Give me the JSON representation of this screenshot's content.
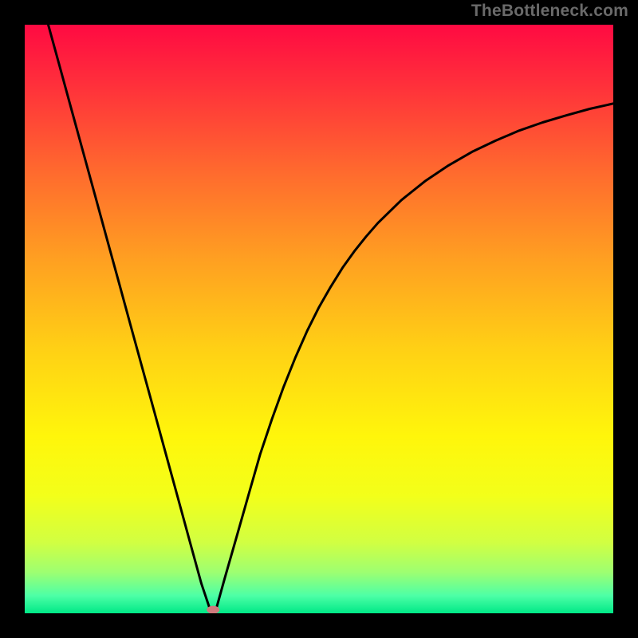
{
  "watermark": "TheBottleneck.com",
  "chart_data": {
    "type": "line",
    "title": "",
    "xlabel": "",
    "ylabel": "",
    "xlim": [
      0,
      100
    ],
    "ylim": [
      0,
      100
    ],
    "grid": false,
    "legend": false,
    "series": [
      {
        "name": "bottleneck-curve",
        "x": [
          4,
          6,
          8,
          10,
          12,
          14,
          16,
          18,
          20,
          22,
          24,
          26,
          28,
          30,
          31.5,
          32.5,
          34,
          36,
          38,
          40,
          42,
          44,
          46,
          48,
          50,
          52,
          54,
          56,
          58,
          60,
          64,
          68,
          72,
          76,
          80,
          84,
          88,
          92,
          96,
          100
        ],
        "values": [
          100,
          92.7,
          85.4,
          78.1,
          70.8,
          63.5,
          56.2,
          48.9,
          41.6,
          34.3,
          27.0,
          19.7,
          12.4,
          5.1,
          0.6,
          0.6,
          6.0,
          13.0,
          20.0,
          27.0,
          33.0,
          38.5,
          43.5,
          48.0,
          52.0,
          55.5,
          58.7,
          61.5,
          64.0,
          66.3,
          70.2,
          73.4,
          76.1,
          78.4,
          80.3,
          82.0,
          83.4,
          84.6,
          85.7,
          86.6
        ]
      }
    ],
    "annotations": [
      {
        "name": "min-marker",
        "x": 32,
        "y": 0.6,
        "shape": "ellipse",
        "color": "#cf7a7d"
      }
    ],
    "background_gradient": {
      "type": "vertical",
      "stops": [
        {
          "pos": 0.0,
          "color": "#ff0a42"
        },
        {
          "pos": 0.1,
          "color": "#ff2f3b"
        },
        {
          "pos": 0.25,
          "color": "#ff6a2e"
        },
        {
          "pos": 0.4,
          "color": "#ffa021"
        },
        {
          "pos": 0.55,
          "color": "#ffd015"
        },
        {
          "pos": 0.7,
          "color": "#fff60b"
        },
        {
          "pos": 0.8,
          "color": "#f3ff1a"
        },
        {
          "pos": 0.88,
          "color": "#d1ff42"
        },
        {
          "pos": 0.93,
          "color": "#9eff71"
        },
        {
          "pos": 0.97,
          "color": "#4dffa6"
        },
        {
          "pos": 1.0,
          "color": "#00e887"
        }
      ]
    }
  }
}
